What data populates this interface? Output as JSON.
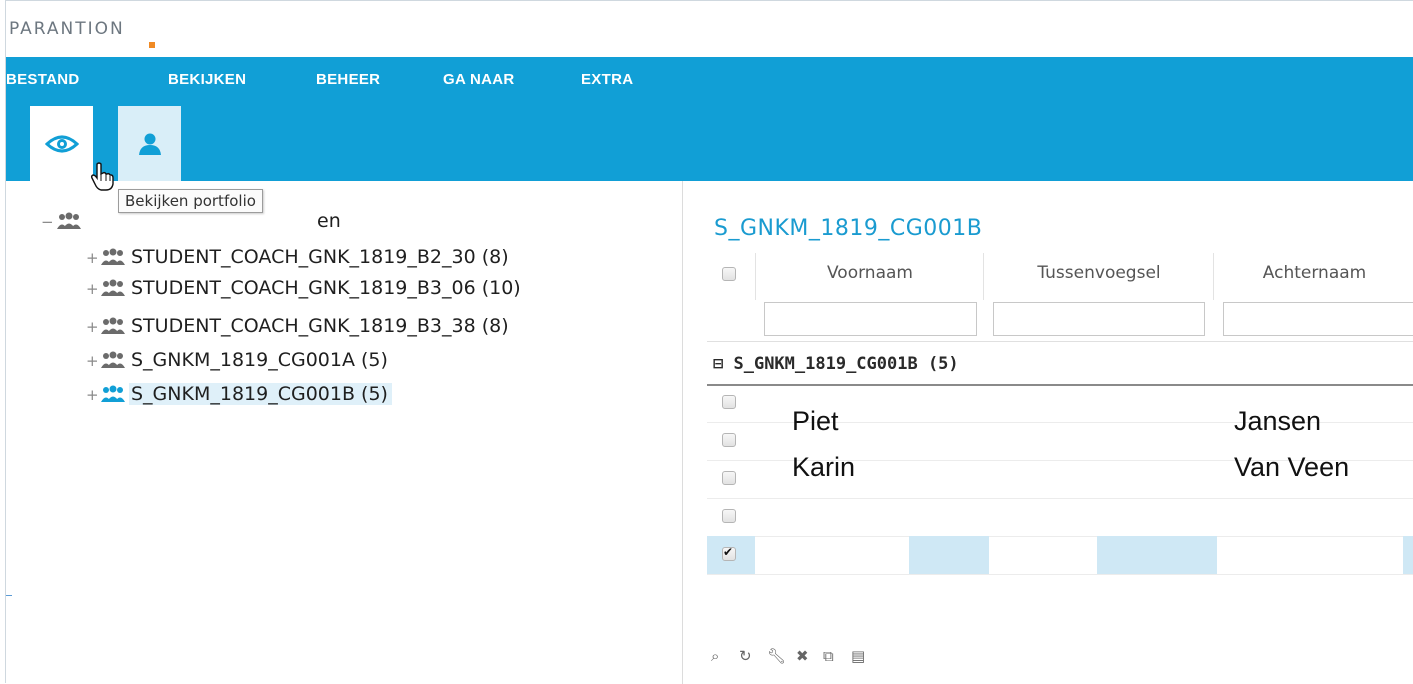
{
  "app": {
    "logo_text": "PARANTION"
  },
  "menu": {
    "items": [
      "BESTAND",
      "BEKIJKEN",
      "BEHEER",
      "GA NAAR",
      "EXTRA"
    ]
  },
  "toolbar": {
    "buttons": [
      {
        "icon": "eye-icon",
        "active": true
      },
      {
        "icon": "person-icon",
        "active": false
      }
    ]
  },
  "tooltip": {
    "text": "Bekijken portfolio"
  },
  "tree": {
    "root_label_visible": "en",
    "items": [
      {
        "label": "STUDENT_COACH_GNK_1819_B2_30 (8)",
        "selected": false
      },
      {
        "label": "STUDENT_COACH_GNK_1819_B3_06 (10)",
        "selected": false
      },
      {
        "label": "STUDENT_COACH_GNK_1819_B3_38 (8)",
        "selected": false
      },
      {
        "label": "S_GNKM_1819_CG001A (5)",
        "selected": false
      },
      {
        "label": "S_GNKM_1819_CG001B (5)",
        "selected": true
      }
    ]
  },
  "panel": {
    "title": "S_GNKM_1819_CG001B",
    "columns": [
      "Voornaam",
      "Tussenvoegsel",
      "Achternaam"
    ],
    "group_label": "S_GNKM_1819_CG001B (5)",
    "rows": [
      {
        "voornaam": "Piet",
        "tussenvoegsel": "",
        "achternaam": "Jansen",
        "checked": false
      },
      {
        "voornaam": "Karin",
        "tussenvoegsel": "",
        "achternaam": "Van Veen",
        "checked": false
      },
      {
        "voornaam": "",
        "tussenvoegsel": "",
        "achternaam": "",
        "checked": false
      },
      {
        "voornaam": "",
        "tussenvoegsel": "",
        "achternaam": "",
        "checked": false
      },
      {
        "voornaam": "",
        "tussenvoegsel": "",
        "achternaam": "",
        "checked": true
      }
    ],
    "footer_tools": [
      "search-icon",
      "refresh-icon",
      "wrench-icon",
      "delete-icon",
      "copy-icon",
      "save-icon"
    ]
  },
  "colors": {
    "brand_blue": "#119fd6",
    "accent_orange": "#f08a24",
    "title_blue": "#1a9bd0",
    "selected_bg": "#dff0f9"
  }
}
